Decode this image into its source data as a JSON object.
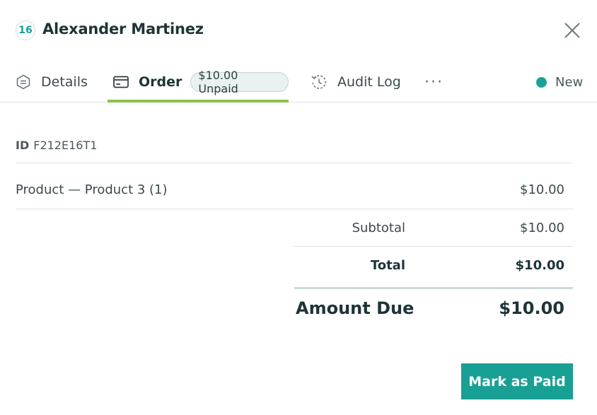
{
  "header": {
    "number": "16",
    "name": "Alexander Martinez",
    "close_icon": "close-icon"
  },
  "tabs": [
    {
      "label": "Details",
      "icon": "document-tag-icon"
    },
    {
      "label": "Order",
      "icon": "card-icon",
      "pill": "$10.00 Unpaid",
      "active": true
    },
    {
      "label": "Audit Log",
      "icon": "history-icon"
    }
  ],
  "more_label": "···",
  "status": {
    "label": "New",
    "color": "#17a39a"
  },
  "order": {
    "id_label": "ID",
    "id_value": "F212E16T1",
    "line_items": [
      {
        "description": "Product — Product 3 (1)",
        "amount": "$10.00"
      }
    ],
    "subtotal_label": "Subtotal",
    "subtotal_value": "$10.00",
    "total_label": "Total",
    "total_value": "$10.00",
    "amount_due_label": "Amount Due",
    "amount_due_value": "$10.00"
  },
  "actions": {
    "mark_paid_label": "Mark as Paid"
  },
  "colors": {
    "accent": "#19a094",
    "active_tab_underline": "#8bc34a"
  }
}
